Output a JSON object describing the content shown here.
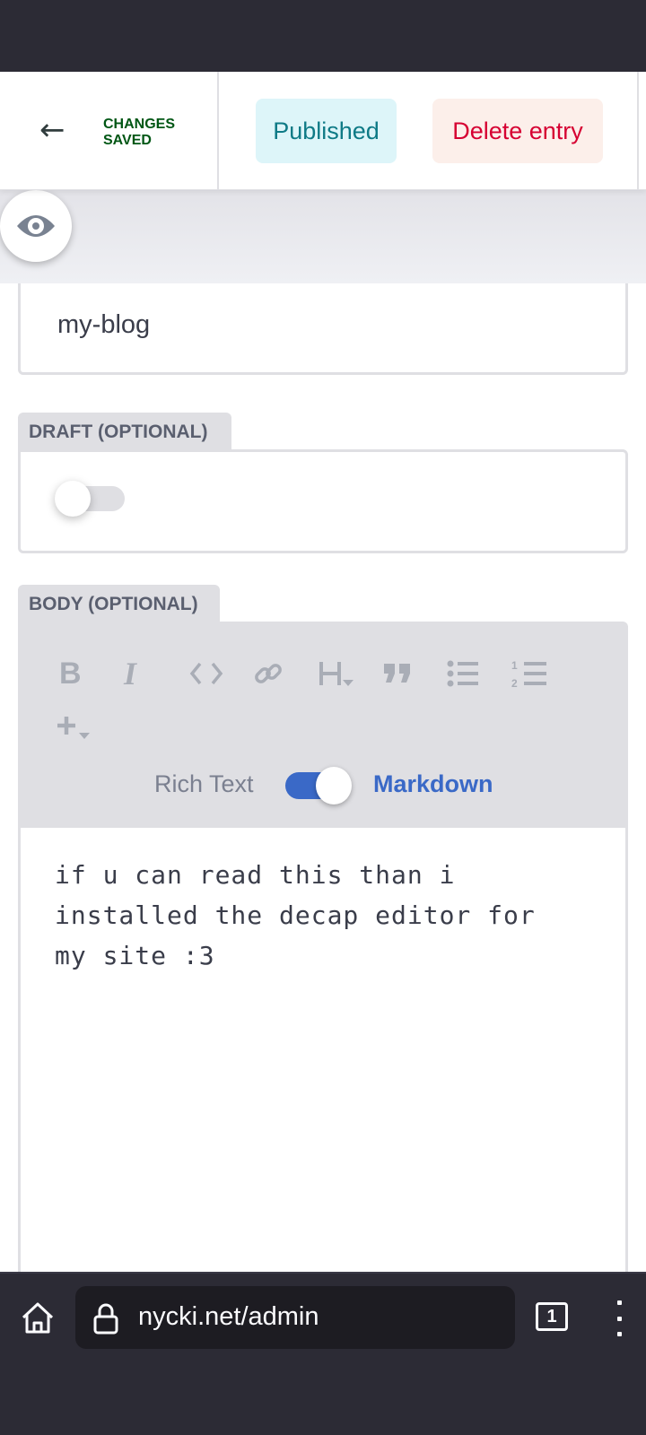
{
  "toolbar": {
    "back_icon": "arrow-left-icon",
    "status_line1": "CHANGES",
    "status_line2": "SAVED",
    "published_label": "Published",
    "delete_label": "Delete entry",
    "colors": {
      "saved": "#005614",
      "published_bg": "#ddf5f9",
      "published_text": "#0e7a86",
      "delete_bg": "#fcefea",
      "delete_text": "#d60032"
    }
  },
  "preview": {
    "toggle_icon": "eye-icon"
  },
  "fields": {
    "title_value": "my-blog",
    "draft": {
      "label": "DRAFT (OPTIONAL)",
      "enabled": false
    },
    "body": {
      "label": "BODY (OPTIONAL)",
      "toolbar_buttons": [
        {
          "name": "bold",
          "icon": "bold-icon"
        },
        {
          "name": "italic",
          "icon": "italic-icon"
        },
        {
          "name": "code",
          "icon": "code-icon"
        },
        {
          "name": "link",
          "icon": "link-icon"
        },
        {
          "name": "heading",
          "icon": "heading-dropdown-icon"
        },
        {
          "name": "quote",
          "icon": "quote-icon"
        },
        {
          "name": "bulleted-list",
          "icon": "bulleted-list-icon"
        },
        {
          "name": "numbered-list",
          "icon": "numbered-list-icon"
        }
      ],
      "add_component_icon": "plus-dropdown-icon",
      "mode_rich_label": "Rich Text",
      "mode_markdown_label": "Markdown",
      "markdown_mode_on": true,
      "content": "if u can read this than i installed the decap editor for my site :3",
      "accent_color": "#3a69c7"
    }
  },
  "browser": {
    "url": "nycki.net/admin",
    "tab_count": "1",
    "home_icon": "home-icon",
    "lock_icon": "lock-icon",
    "menu_icon": "kebab-menu-icon"
  }
}
